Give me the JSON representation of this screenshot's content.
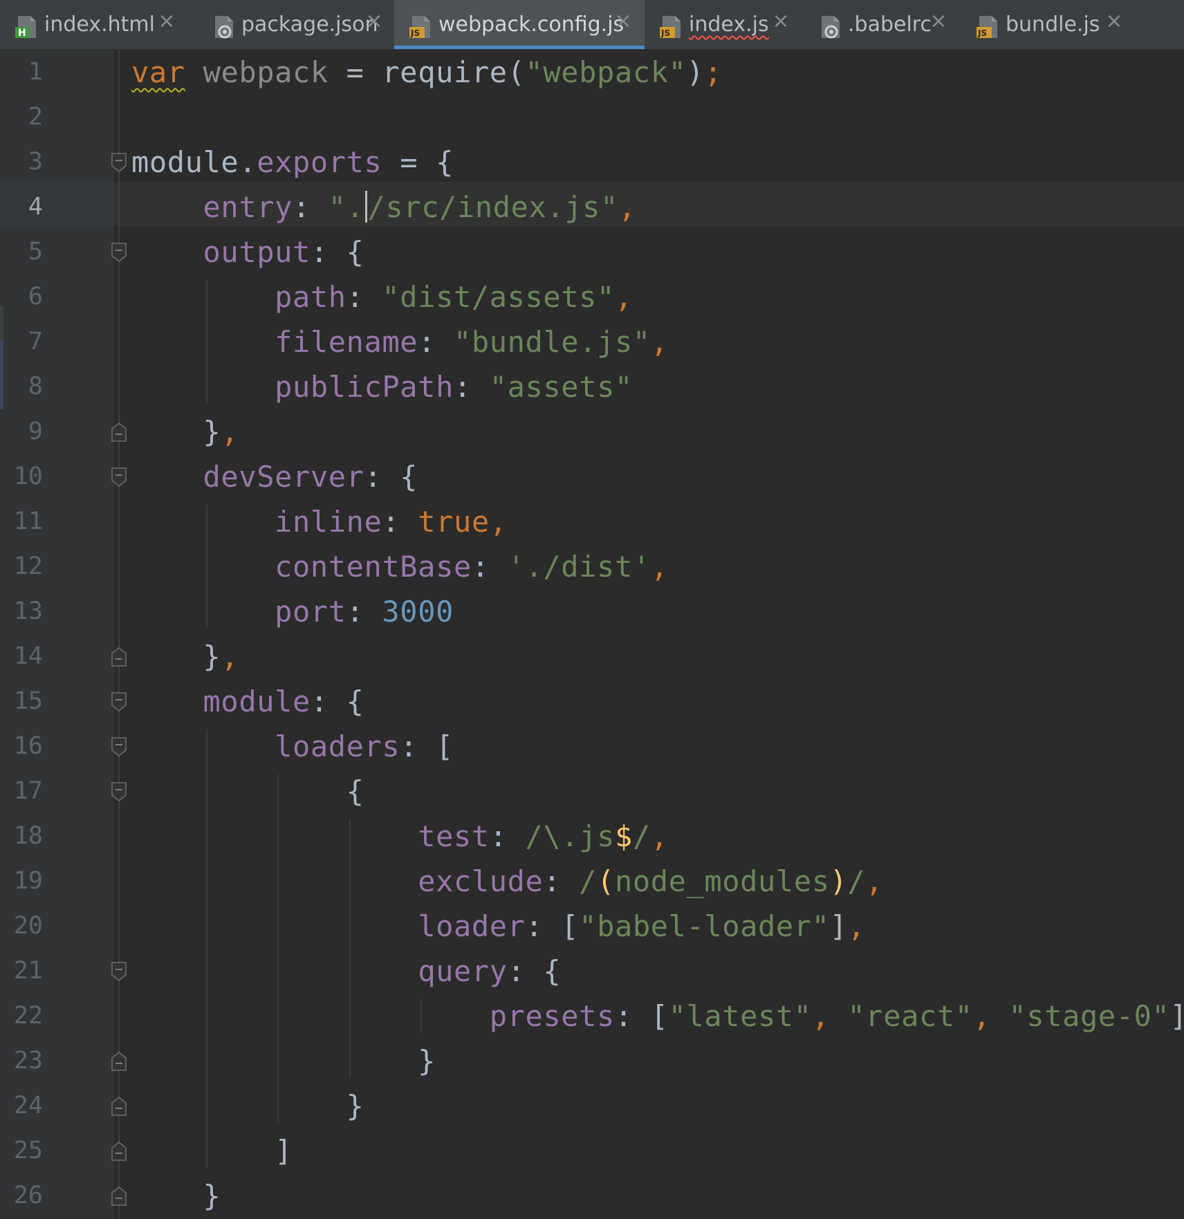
{
  "tabs": [
    {
      "label": "index.html",
      "icon": "html-file-icon",
      "active": false,
      "error": false
    },
    {
      "label": "package.json",
      "icon": "json-file-icon",
      "active": false,
      "error": false
    },
    {
      "label": "webpack.config.js",
      "icon": "js-file-icon",
      "active": true,
      "error": false
    },
    {
      "label": "index.js",
      "icon": "js-file-icon",
      "active": false,
      "error": true
    },
    {
      "label": ".babelrc",
      "icon": "config-file-icon",
      "active": false,
      "error": false
    },
    {
      "label": "bundle.js",
      "icon": "js-file-icon",
      "active": false,
      "error": false
    }
  ],
  "tab_close_glyph": "×",
  "editor": {
    "current_line": 4,
    "line_numbers": [
      "1",
      "2",
      "3",
      "4",
      "5",
      "6",
      "7",
      "8",
      "9",
      "10",
      "11",
      "12",
      "13",
      "14",
      "15",
      "16",
      "17",
      "18",
      "19",
      "20",
      "21",
      "22",
      "23",
      "24",
      "25",
      "26"
    ],
    "lines": [
      {
        "t": [
          [
            "kw",
            "var"
          ],
          [
            "plain",
            " "
          ],
          [
            "muted",
            "webpack"
          ],
          [
            "plain",
            " = require("
          ],
          [
            "str",
            "\"webpack\""
          ],
          [
            "plain",
            ")"
          ],
          [
            "punc",
            ";"
          ]
        ]
      },
      {
        "t": []
      },
      {
        "t": [
          [
            "plain",
            "module."
          ],
          [
            "var",
            "exports"
          ],
          [
            "plain",
            " = {"
          ]
        ]
      },
      {
        "t": [
          [
            "plain",
            "    "
          ],
          [
            "prop",
            "entry"
          ],
          [
            "plain",
            ": "
          ],
          [
            "str",
            "\"."
          ],
          [
            "cursor",
            ""
          ],
          [
            "str",
            "/src/index.js\""
          ],
          [
            "punc",
            ","
          ]
        ]
      },
      {
        "t": [
          [
            "plain",
            "    "
          ],
          [
            "prop",
            "output"
          ],
          [
            "plain",
            ": {"
          ]
        ]
      },
      {
        "t": [
          [
            "plain",
            "        "
          ],
          [
            "prop",
            "path"
          ],
          [
            "plain",
            ": "
          ],
          [
            "str",
            "\"dist/assets\""
          ],
          [
            "punc",
            ","
          ]
        ]
      },
      {
        "t": [
          [
            "plain",
            "        "
          ],
          [
            "prop",
            "filename"
          ],
          [
            "plain",
            ": "
          ],
          [
            "str",
            "\"bundle.js\""
          ],
          [
            "punc",
            ","
          ]
        ]
      },
      {
        "t": [
          [
            "plain",
            "        "
          ],
          [
            "prop",
            "publicPath"
          ],
          [
            "plain",
            ": "
          ],
          [
            "str",
            "\"assets\""
          ]
        ]
      },
      {
        "t": [
          [
            "plain",
            "    }"
          ],
          [
            "punc",
            ","
          ]
        ]
      },
      {
        "t": [
          [
            "plain",
            "    "
          ],
          [
            "prop",
            "devServer"
          ],
          [
            "plain",
            ": {"
          ]
        ]
      },
      {
        "t": [
          [
            "plain",
            "        "
          ],
          [
            "prop",
            "inline"
          ],
          [
            "plain",
            ": "
          ],
          [
            "kw",
            "true"
          ],
          [
            "punc",
            ","
          ]
        ]
      },
      {
        "t": [
          [
            "plain",
            "        "
          ],
          [
            "prop",
            "contentBase"
          ],
          [
            "plain",
            ": "
          ],
          [
            "str",
            "'./dist'"
          ],
          [
            "punc",
            ","
          ]
        ]
      },
      {
        "t": [
          [
            "plain",
            "        "
          ],
          [
            "prop",
            "port"
          ],
          [
            "plain",
            ": "
          ],
          [
            "num",
            "3000"
          ]
        ]
      },
      {
        "t": [
          [
            "plain",
            "    }"
          ],
          [
            "punc",
            ","
          ]
        ]
      },
      {
        "t": [
          [
            "plain",
            "    "
          ],
          [
            "prop",
            "module"
          ],
          [
            "plain",
            ": {"
          ]
        ]
      },
      {
        "t": [
          [
            "plain",
            "        "
          ],
          [
            "prop",
            "loaders"
          ],
          [
            "plain",
            ": ["
          ]
        ]
      },
      {
        "t": [
          [
            "plain",
            "            {"
          ]
        ]
      },
      {
        "t": [
          [
            "plain",
            "                "
          ],
          [
            "prop",
            "test"
          ],
          [
            "plain",
            ": "
          ],
          [
            "regex",
            "/\\."
          ],
          [
            "regex",
            "js"
          ],
          [
            "rgx-op",
            "$"
          ],
          [
            "regex",
            "/"
          ],
          [
            "punc",
            ","
          ]
        ]
      },
      {
        "t": [
          [
            "plain",
            "                "
          ],
          [
            "prop",
            "exclude"
          ],
          [
            "plain",
            ": "
          ],
          [
            "regex",
            "/"
          ],
          [
            "rgx-op",
            "("
          ],
          [
            "regex",
            "node_modules"
          ],
          [
            "rgx-op",
            ")"
          ],
          [
            "regex",
            "/"
          ],
          [
            "punc",
            ","
          ]
        ]
      },
      {
        "t": [
          [
            "plain",
            "                "
          ],
          [
            "prop",
            "loader"
          ],
          [
            "plain",
            ": ["
          ],
          [
            "str",
            "\"babel-loader\""
          ],
          [
            "plain",
            "]"
          ],
          [
            "punc",
            ","
          ]
        ]
      },
      {
        "t": [
          [
            "plain",
            "                "
          ],
          [
            "prop",
            "query"
          ],
          [
            "plain",
            ": {"
          ]
        ]
      },
      {
        "t": [
          [
            "plain",
            "                    "
          ],
          [
            "prop",
            "presets"
          ],
          [
            "plain",
            ": ["
          ],
          [
            "str",
            "\"latest\""
          ],
          [
            "punc",
            ", "
          ],
          [
            "str",
            "\"react\""
          ],
          [
            "punc",
            ", "
          ],
          [
            "str",
            "\"stage-0\""
          ],
          [
            "plain",
            "]"
          ]
        ]
      },
      {
        "t": [
          [
            "plain",
            "                }"
          ]
        ]
      },
      {
        "t": [
          [
            "plain",
            "            }"
          ]
        ]
      },
      {
        "t": [
          [
            "plain",
            "        ]"
          ]
        ]
      },
      {
        "t": [
          [
            "plain",
            "    }"
          ]
        ]
      }
    ]
  }
}
